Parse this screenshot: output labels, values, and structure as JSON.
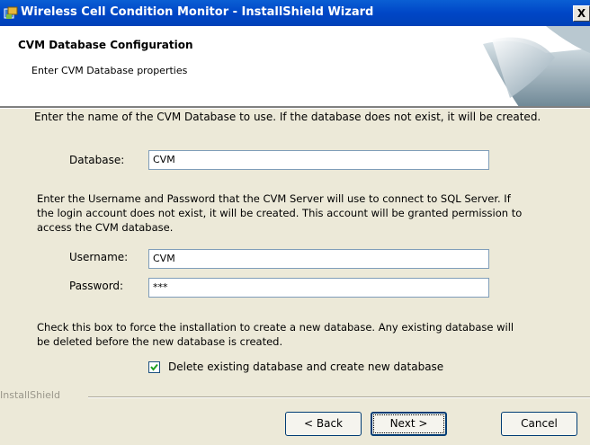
{
  "window": {
    "title": "Wireless Cell Condition Monitor - InstallShield Wizard",
    "close_glyph": "X"
  },
  "header": {
    "title": "CVM Database Configuration",
    "subtitle": "Enter CVM Database properties"
  },
  "content": {
    "intro_text": "Enter the name of the CVM Database to use.  If the database does not exist, it will be created.",
    "database_label": "Database:",
    "database_value": "CVM",
    "credentials_text_line1": "Enter the Username and Password that the CVM Server will use to connect to SQL Server.  If",
    "credentials_text_line2": "the login account does not exist, it will be created.  This account will be granted permission to",
    "credentials_text_line3": "access the CVM database.",
    "username_label": "Username:",
    "username_value": "CVM",
    "password_label": "Password:",
    "password_value": "***",
    "force_text_line1": "Check this box to force the installation to create a new database.  Any existing database will",
    "force_text_line2": "be deleted before the new database is created.",
    "checkbox_label": "Delete existing database and create new database",
    "checkbox_checked": true
  },
  "footer": {
    "brand_label": "InstallShield",
    "back_label": "< Back",
    "next_label": "Next >",
    "cancel_label": "Cancel"
  },
  "colors": {
    "titlebar": "#0046c6",
    "dialog_background": "#ece9d8",
    "field_border": "#7f9db9"
  }
}
